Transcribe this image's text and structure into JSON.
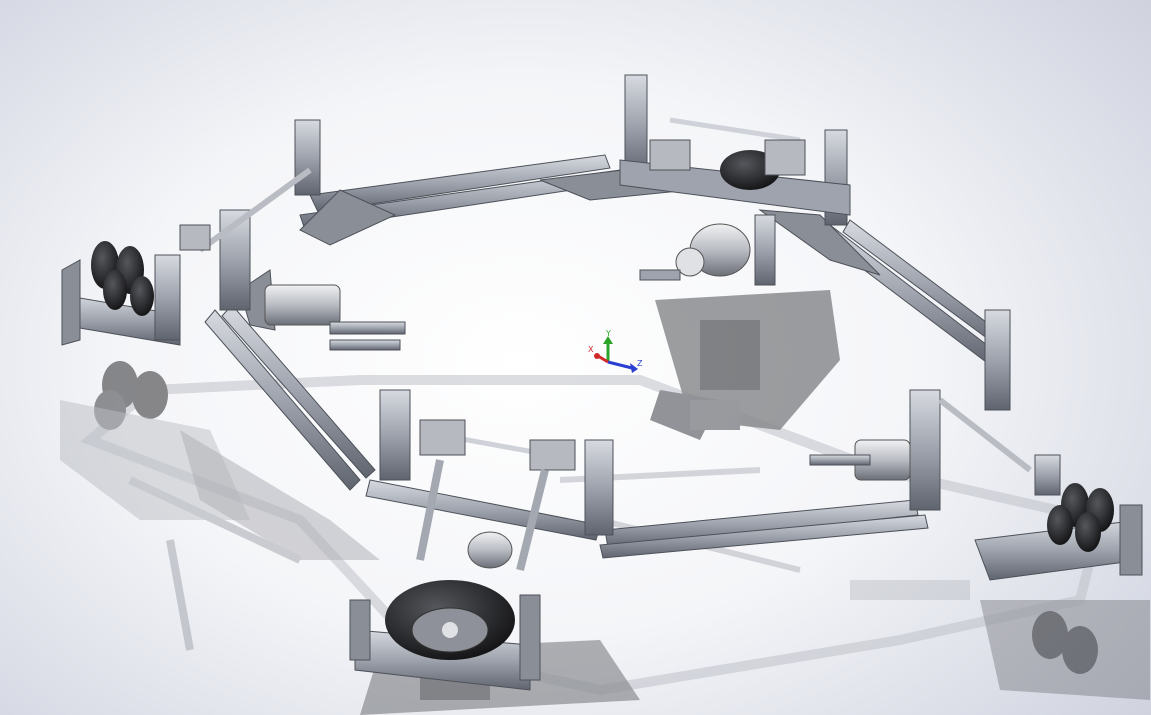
{
  "window": {
    "background": "#eef0f5"
  },
  "triad": {
    "x_label": "X",
    "y_label": "Y",
    "z_label": "Z",
    "x_color": "#d22a2a",
    "y_color": "#2aa52a",
    "z_color": "#2a3fd2"
  },
  "model": {
    "frame_color": "#9ea3ad",
    "frame_dark": "#5c616b",
    "wheel_color": "#1c1c1e",
    "motor_color": "#c9ccd2",
    "shadow_color": "#3a3c42",
    "modules": [
      {
        "id": "left",
        "icon": "omni-wheel-module"
      },
      {
        "id": "back",
        "icon": "omni-wheel-module"
      },
      {
        "id": "right",
        "icon": "omni-wheel-module"
      },
      {
        "id": "front",
        "icon": "omni-wheel-module"
      }
    ]
  }
}
